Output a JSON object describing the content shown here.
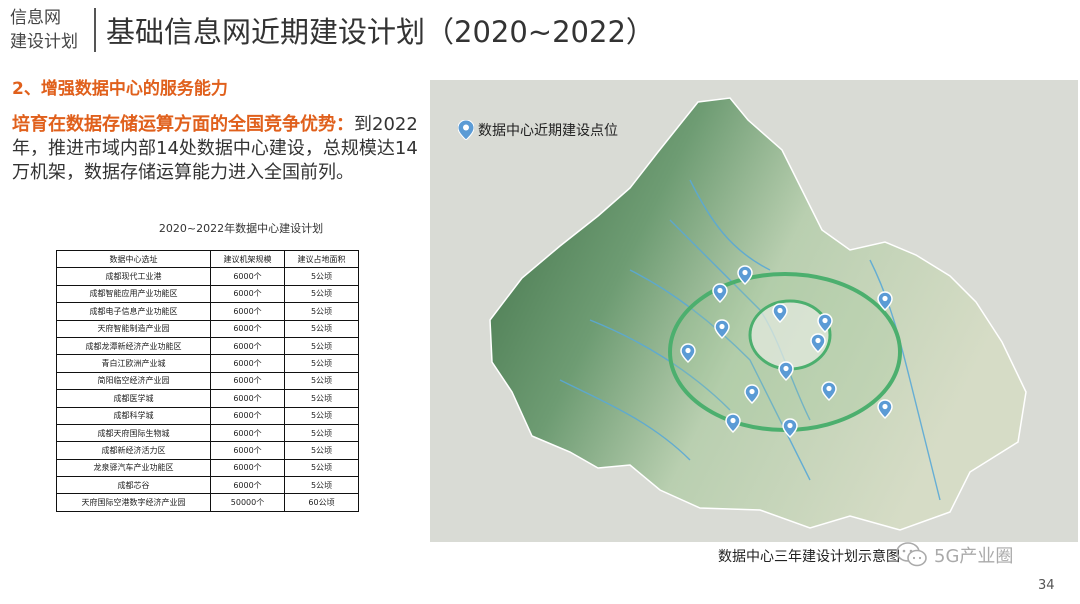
{
  "header": {
    "section_line1": "信息网",
    "section_line2": "建设计划",
    "title": "基础信息网近期建设计划（2020~2022）"
  },
  "subheading": "2、增强数据中心的服务能力",
  "paragraph": {
    "highlight": "培育在数据存储运算方面的全国竞争优势：",
    "text": "到2022年，推进市域内部14处数据中心建设，总规模达14万机架，数据存储运算能力进入全国前列。"
  },
  "table": {
    "caption": "2020~2022年数据中心建设计划",
    "headers": [
      "数据中心选址",
      "建议机架规模",
      "建议占地面积"
    ],
    "rows": [
      [
        "成都现代工业港",
        "6000个",
        "5公顷"
      ],
      [
        "成都智能应用产业功能区",
        "6000个",
        "5公顷"
      ],
      [
        "成都电子信息产业功能区",
        "6000个",
        "5公顷"
      ],
      [
        "天府智能制造产业园",
        "6000个",
        "5公顷"
      ],
      [
        "成都龙潭新经济产业功能区",
        "6000个",
        "5公顷"
      ],
      [
        "青白江欧洲产业城",
        "6000个",
        "5公顷"
      ],
      [
        "简阳临空经济产业园",
        "6000个",
        "5公顷"
      ],
      [
        "成都医学城",
        "6000个",
        "5公顷"
      ],
      [
        "成都科学城",
        "6000个",
        "5公顷"
      ],
      [
        "成都天府国际生物城",
        "6000个",
        "5公顷"
      ],
      [
        "成都新经济活力区",
        "6000个",
        "5公顷"
      ],
      [
        "龙泉驿汽车产业功能区",
        "6000个",
        "5公顷"
      ],
      [
        "成都芯谷",
        "6000个",
        "5公顷"
      ],
      [
        "天府国际空港数字经济产业园",
        "50000个",
        "60公顷"
      ]
    ]
  },
  "map": {
    "legend_label": "数据中心近期建设点位",
    "caption": "数据中心三年建设计划示意图",
    "pin_count": 14,
    "pin_color": "#5b9bd5"
  },
  "footer": {
    "wechat_name": "5G产业圈",
    "page_number": "34"
  },
  "colors": {
    "accent": "#e0601c",
    "ring": "#4caf6e",
    "terrain_dark": "#3f7a4c"
  }
}
